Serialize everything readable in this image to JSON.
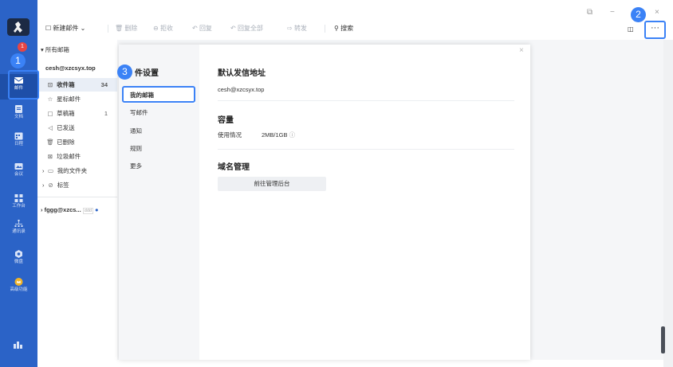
{
  "rail": {
    "badge": "1",
    "items": [
      {
        "label": "邮件"
      },
      {
        "label": "文档"
      },
      {
        "label": "日程"
      },
      {
        "label": "会议"
      },
      {
        "label": "工作台"
      },
      {
        "label": "通讯录"
      },
      {
        "label": "微盘"
      },
      {
        "label": "高级功能"
      }
    ]
  },
  "markers": {
    "one": "1",
    "two": "2",
    "three": "3"
  },
  "toolbar": {
    "compose": "新建邮件",
    "delete": "删除",
    "reject": "拒收",
    "reply": "回复",
    "reply_all": "回复全部",
    "forward": "转发",
    "search": "搜索",
    "more": "···"
  },
  "tree": {
    "all_mail": "所有邮箱",
    "account1": "cesh@xzcsyx.top",
    "inbox": "收件箱",
    "inbox_count": "34",
    "starred": "星标邮件",
    "drafts": "草稿箱",
    "drafts_count": "1",
    "sent": "已发送",
    "deleted": "已删除",
    "spam": "垃圾邮件",
    "my_folders": "我的文件夹",
    "tags": "标签",
    "account2": "fggg@xzcs...",
    "account2_tag": "ddd"
  },
  "dialog": {
    "title": "邮件设置",
    "title_visible": "件设置",
    "nav": [
      "我的邮箱",
      "写邮件",
      "通知",
      "规则",
      "更多"
    ],
    "close": "×",
    "sections": {
      "default_address_title": "默认发信地址",
      "default_address": "cesh@xzcsyx.top",
      "capacity_title": "容量",
      "usage_label": "使用情况",
      "usage_value": "2MB/1GB",
      "domain_title": "域名管理",
      "goto_admin": "前往管理后台"
    }
  }
}
